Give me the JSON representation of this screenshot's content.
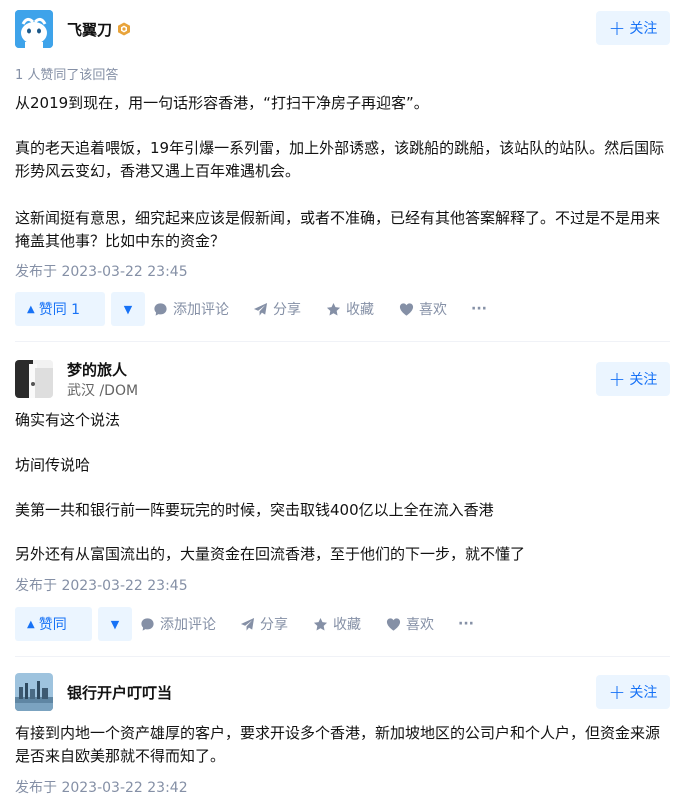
{
  "answers": [
    {
      "author": "飞翼刀",
      "follow_label": "关注",
      "approve_note": "1 人赞同了该回答",
      "paragraphs": [
        "从2019到现在，用一句话形容香港，“打扫干净房子再迎客”。",
        "真的老天追着喂饭，19年引爆一系列雷，加上外部诱惑，该跳船的跳船，该站队的站队。然后国际形势风云变幻，香港又遇上百年难遇机会。",
        "这新闻挺有意思，细究起来应该是假新闻，或者不准确，已经有其他答案解释了。不过是不是用来掩盖其他事？比如中东的资金？"
      ],
      "published": "发布于 2023-03-22 23:45",
      "vote_label": "赞同 1",
      "comment_label": "添加评论",
      "share_label": "分享",
      "collect_label": "收藏",
      "like_label": "喜欢",
      "more_label": "···"
    },
    {
      "author": "梦的旅人",
      "headline": "武汉 /DOM",
      "follow_label": "关注",
      "paragraphs": [
        "确实有这个说法",
        "坊间传说哈",
        "美第一共和银行前一阵要玩完的时候，突击取钱400亿以上全在流入香港",
        "另外还有从富国流出的，大量资金在回流香港，至于他们的下一步，就不懂了"
      ],
      "published": "发布于 2023-03-22 23:45",
      "vote_label": "赞同",
      "comment_label": "添加评论",
      "share_label": "分享",
      "collect_label": "收藏",
      "like_label": "喜欢",
      "more_label": "···"
    },
    {
      "author": "银行开户叮叮当",
      "follow_label": "关注",
      "paragraphs": [
        "有接到内地一个资产雄厚的客户，要求开设多个香港，新加坡地区的公司户和个人户，但资金来源是否来自欧美那就不得而知了。"
      ],
      "published": "发布于 2023-03-22 23:42"
    }
  ],
  "colors": {
    "accent": "#1772f6",
    "accent_bg": "#ebf5ff",
    "meta": "#8590a6",
    "text": "#121212"
  },
  "icons": {
    "vote_up": "triangle-up-icon",
    "vote_down": "triangle-down-icon",
    "comment": "comment-bubble-icon",
    "share": "paper-plane-icon",
    "collect": "star-icon",
    "like": "heart-icon",
    "follow": "plus-icon",
    "badge": "hexagon-badge-icon"
  }
}
